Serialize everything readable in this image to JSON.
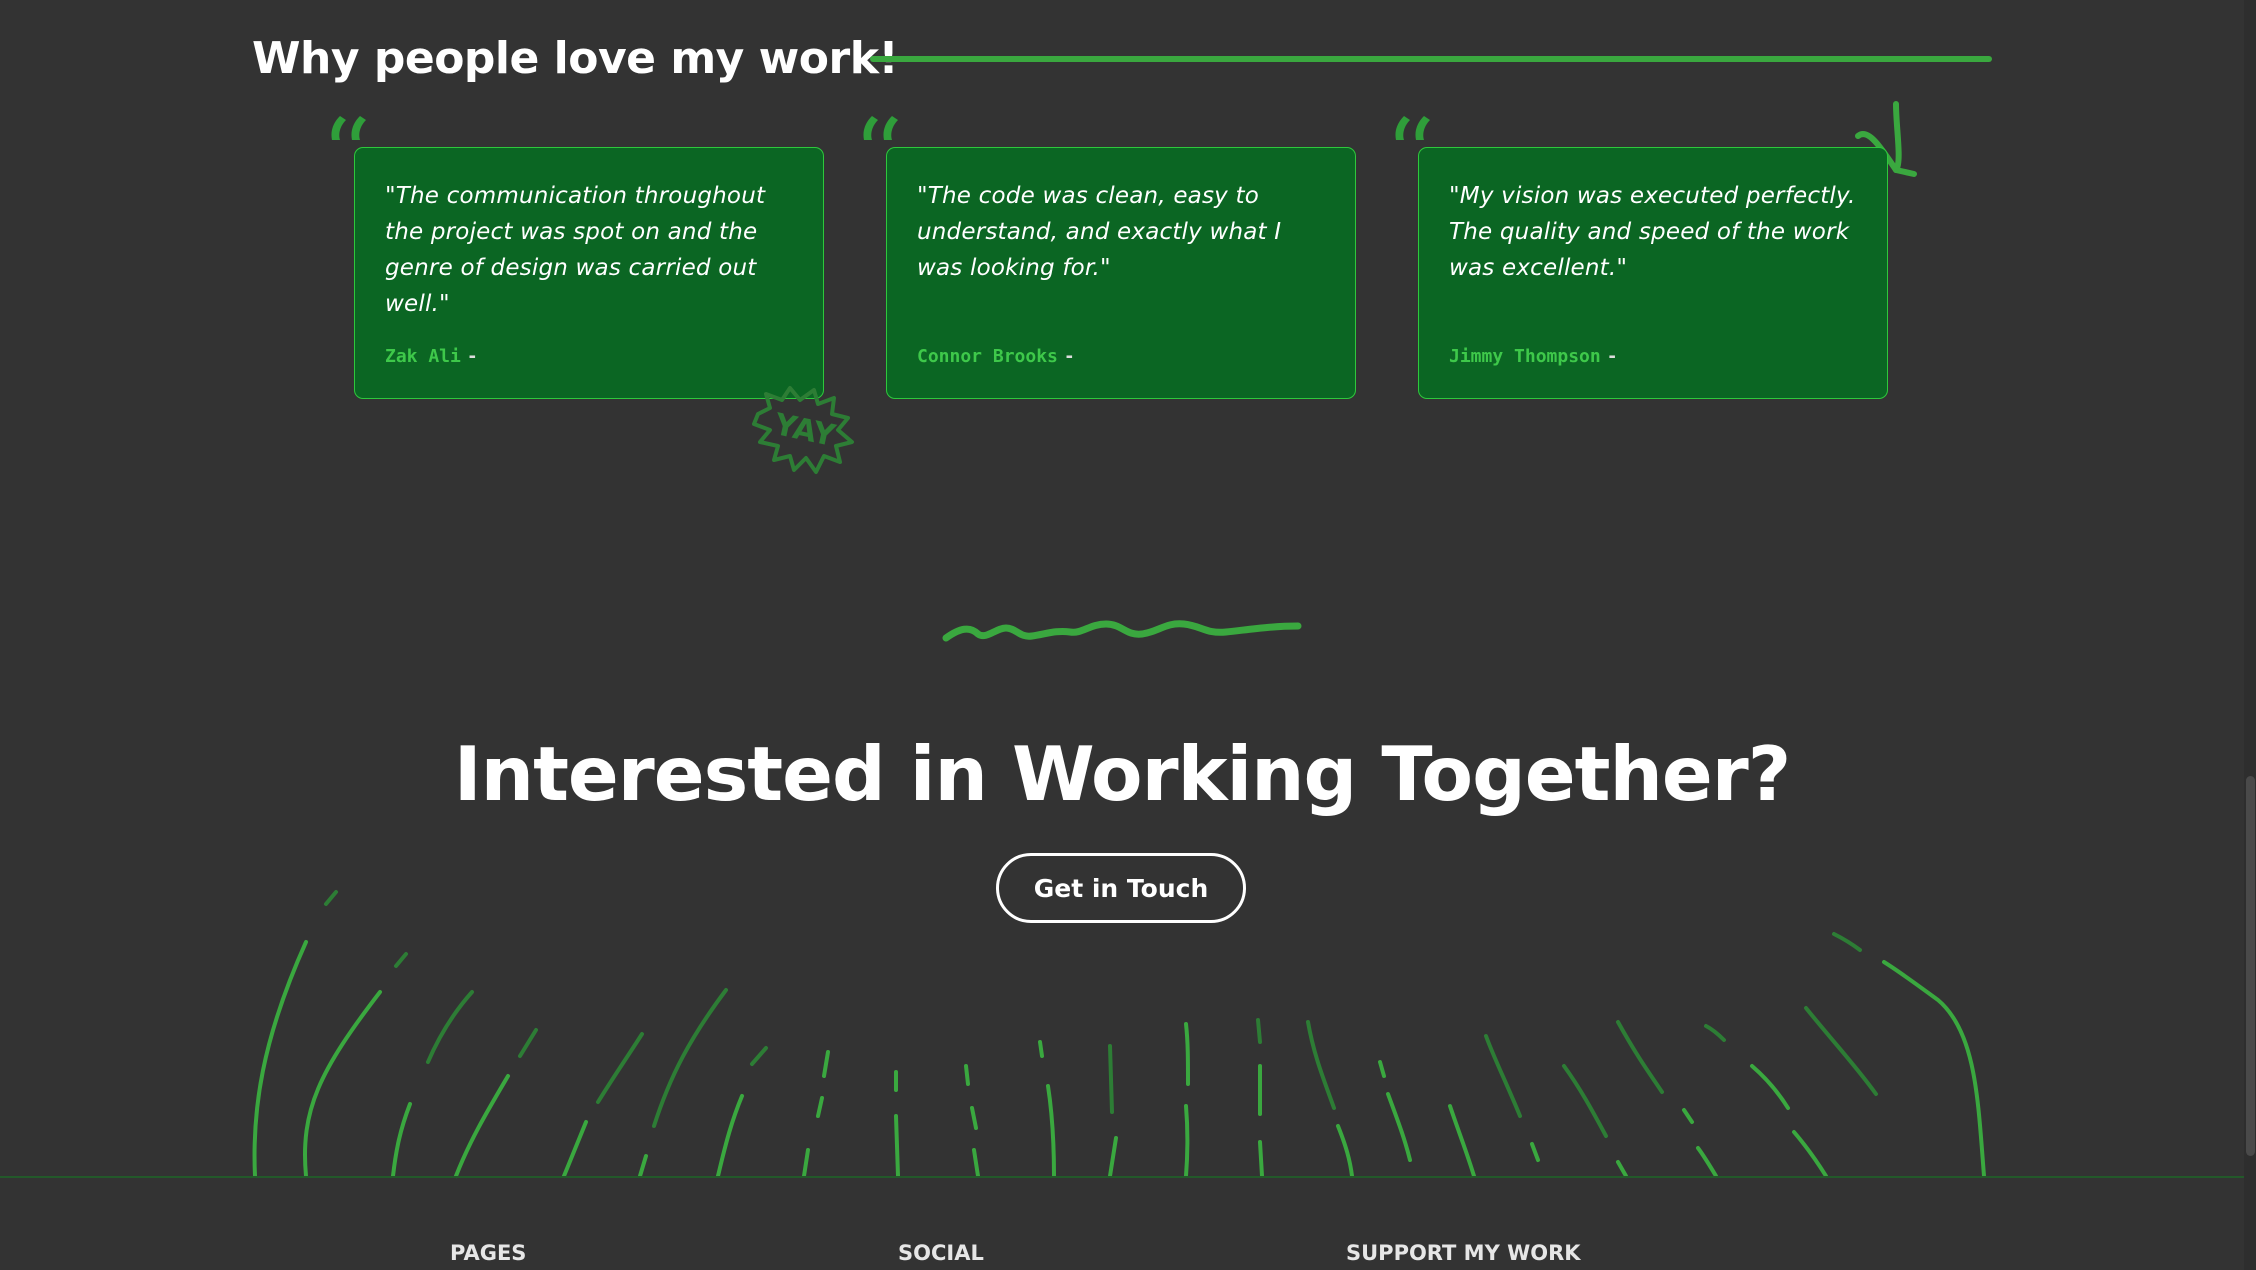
{
  "testimonials": {
    "title": "Why people love my work!",
    "items": [
      {
        "quote": "\"The communication throughout the project was spot on and the genre of design was carried out well.\"",
        "author": "Zak Ali",
        "dash": "-"
      },
      {
        "quote": "\"The code was clean, easy to understand, and exactly what I was looking for.\"",
        "author": "Connor Brooks",
        "dash": "-"
      },
      {
        "quote": "\"My vision was executed perfectly. The quality and speed of the work was excellent.\"",
        "author": "Jimmy Thompson",
        "dash": "-"
      }
    ],
    "sticker_text": "YAY"
  },
  "cta": {
    "title": "Interested in Working Together?",
    "button_label": "Get in Touch"
  },
  "footer": {
    "headings": [
      "PAGES",
      "SOCIAL",
      "SUPPORT MY WORK"
    ]
  },
  "colors": {
    "background": "#333333",
    "accent": "#3aa83f",
    "card_background": "#0b6623",
    "card_border": "#2ec83c",
    "author_text": "#3ec84a"
  },
  "icons": {
    "quote_mark": "opening-quote-icon",
    "squiggle": "wavy-line-doodle",
    "arrow_doodle": "scribble-doodle",
    "sticker": "yay-starburst-sticker"
  }
}
